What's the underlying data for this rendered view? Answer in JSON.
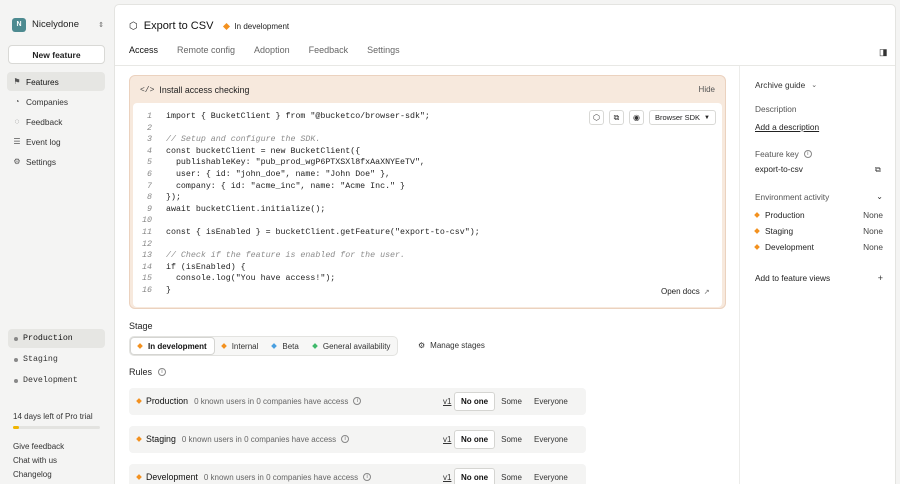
{
  "sidebar": {
    "org_initial": "N",
    "org_name": "Nicelydone",
    "new_feature_label": "New feature",
    "nav": [
      {
        "label": "Features",
        "icon": "flag-icon"
      },
      {
        "label": "Companies",
        "icon": "company-icon"
      },
      {
        "label": "Feedback",
        "icon": "chat-icon"
      },
      {
        "label": "Event log",
        "icon": "list-icon"
      },
      {
        "label": "Settings",
        "icon": "gear-icon"
      }
    ],
    "environments": [
      "Production",
      "Staging",
      "Development"
    ],
    "trial_text": "14 days left of Pro trial",
    "trial_progress": 0.07,
    "footer_links": [
      "Give feedback",
      "Chat with us",
      "Changelog"
    ]
  },
  "header": {
    "title": "Export to CSV",
    "stage_badge": "In development"
  },
  "tabs": [
    "Access",
    "Remote config",
    "Adoption",
    "Feedback",
    "Settings"
  ],
  "install": {
    "title": "Install access checking",
    "hide_label": "Hide",
    "sdk_select": "Browser SDK",
    "open_docs_label": "Open docs",
    "code_lines": [
      "import { BucketClient } from \"@bucketco/browser-sdk\";",
      "",
      "// Setup and configure the SDK.",
      "const bucketClient = new BucketClient({",
      "  publishableKey: \"pub_prod_wgP6PTXSXl8fxAaXNYEeTV\",",
      "  user: { id: \"john_doe\", name: \"John Doe\" },",
      "  company: { id: \"acme_inc\", name: \"Acme Inc.\" }",
      "});",
      "await bucketClient.initialize();",
      "",
      "const { isEnabled } = bucketClient.getFeature(\"export-to-csv\");",
      "",
      "// Check if the feature is enabled for the user.",
      "if (isEnabled) {",
      "  console.log(\"You have access!\");",
      "}"
    ]
  },
  "stage": {
    "label": "Stage",
    "options": [
      {
        "label": "In development",
        "color": "#f3911f"
      },
      {
        "label": "Internal",
        "color": "#f3911f"
      },
      {
        "label": "Beta",
        "color": "#4a9fe0"
      },
      {
        "label": "General availability",
        "color": "#3fb96b"
      }
    ],
    "manage_label": "Manage stages"
  },
  "rules": {
    "label": "Rules",
    "items": [
      {
        "env": "Production",
        "desc": "0 known users in 0 companies have access",
        "version": "v1"
      },
      {
        "env": "Staging",
        "desc": "0 known users in 0 companies have access",
        "version": "v1"
      },
      {
        "env": "Development",
        "desc": "0 known users in 0 companies have access",
        "version": "v1"
      }
    ],
    "segments": [
      "No one",
      "Some",
      "Everyone"
    ]
  },
  "right_panel": {
    "archive_guide": "Archive guide",
    "description_label": "Description",
    "add_description": "Add a description",
    "feature_key_label": "Feature key",
    "feature_key": "export-to-csv",
    "env_activity_label": "Environment activity",
    "env_activity": [
      {
        "env": "Production",
        "value": "None"
      },
      {
        "env": "Staging",
        "value": "None"
      },
      {
        "env": "Development",
        "value": "None"
      }
    ],
    "add_to_views": "Add to feature views"
  }
}
